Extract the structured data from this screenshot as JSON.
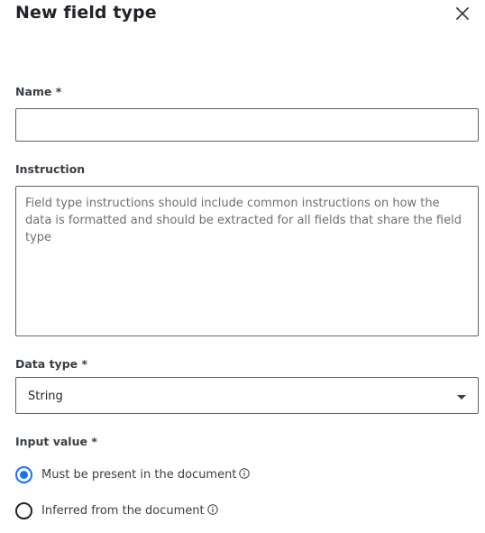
{
  "dialog": {
    "title": "New field type"
  },
  "fields": {
    "name": {
      "label": "Name *",
      "value": "",
      "placeholder": ""
    },
    "instruction": {
      "label": "Instruction",
      "value": "",
      "placeholder": "Field type instructions should include common instructions on how the data is formatted and should be extracted for all fields that share the field type"
    },
    "data_type": {
      "label": "Data type *",
      "selected": "String"
    },
    "input_value": {
      "label": "Input value *",
      "options": [
        {
          "label": "Must be present in the document",
          "checked": true
        },
        {
          "label": "Inferred from the document",
          "checked": false
        }
      ]
    }
  },
  "icons": {
    "close": "close-icon",
    "dropdown": "caret-down-icon",
    "info": "info-icon"
  },
  "colors": {
    "accent": "#1a73e8",
    "border": "#5f6368",
    "text": "#1f2328"
  }
}
